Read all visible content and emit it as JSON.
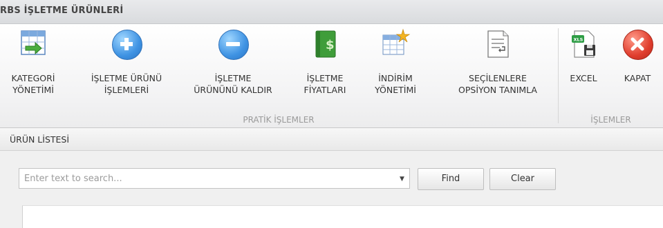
{
  "window": {
    "title": "RBS İŞLETME ÜRÜNLERİ"
  },
  "ribbon": {
    "groups": [
      {
        "label": "PRATİK İŞLEMLER",
        "buttons": [
          {
            "line1": "KATEGORİ",
            "line2": "YÖNETİMİ",
            "icon": "category-table-icon"
          },
          {
            "line1": "İŞLETME ÜRÜNÜ",
            "line2": "İŞLEMLERİ",
            "icon": "plus-circle-icon"
          },
          {
            "line1": "İŞLETME",
            "line2": "ÜRÜNÜNÜ KALDIR",
            "icon": "minus-circle-icon"
          },
          {
            "line1": "İŞLETME",
            "line2": "FİYATLARI",
            "icon": "price-book-icon"
          },
          {
            "line1": "İNDİRİM",
            "line2": "YÖNETİMİ",
            "icon": "discount-table-icon"
          },
          {
            "line1": "SEÇİLENLERE",
            "line2": "OPSİYON TANIMLA",
            "icon": "option-document-icon"
          }
        ]
      },
      {
        "label": "İŞLEMLER",
        "buttons": [
          {
            "line1": "EXCEL",
            "line2": "",
            "icon": "excel-export-icon"
          },
          {
            "line1": "KAPAT",
            "line2": "",
            "icon": "close-circle-icon"
          }
        ]
      }
    ]
  },
  "product_list": {
    "title": "ÜRÜN LİSTESİ",
    "search": {
      "value": "",
      "placeholder": "Enter text to search..."
    },
    "find_label": "Find",
    "clear_label": "Clear"
  },
  "colors": {
    "accent_blue": "#3f93e3",
    "close_red": "#e03e2e",
    "excel_green": "#2e9d45",
    "price_green": "#3f9d3a"
  }
}
